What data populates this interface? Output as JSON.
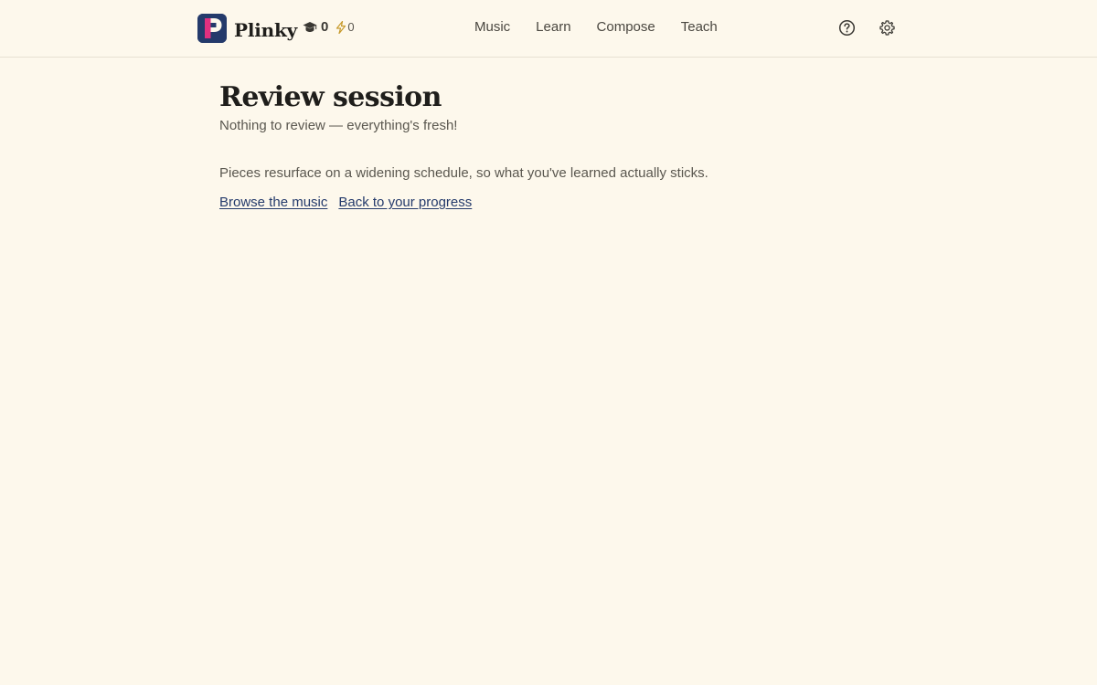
{
  "header": {
    "brand_name": "Plinky",
    "logo_letter": "P",
    "stats": {
      "xp_icon": "graduation-cap-icon",
      "xp_value": "0",
      "streak_icon": "lightning-bolt-icon",
      "streak_value": "0"
    },
    "nav": [
      {
        "label": "Music"
      },
      {
        "label": "Learn"
      },
      {
        "label": "Compose"
      },
      {
        "label": "Teach"
      }
    ],
    "help_icon": "help-circle-icon",
    "settings_icon": "gear-icon"
  },
  "main": {
    "title": "Review session",
    "subtitle": "Nothing to review — everything's fresh!",
    "explainer": "Pieces resurface on a widening schedule, so what you've learned actually sticks.",
    "links": [
      {
        "label": "Browse the music"
      },
      {
        "label": "Back to your progress"
      }
    ]
  },
  "colors": {
    "background": "#fdf8ec",
    "brand_navy": "#243a6b",
    "brand_pink": "#e0307f",
    "text_dark": "#1f1e1b",
    "text_muted": "#5a574f",
    "border": "#e7e1d2"
  }
}
